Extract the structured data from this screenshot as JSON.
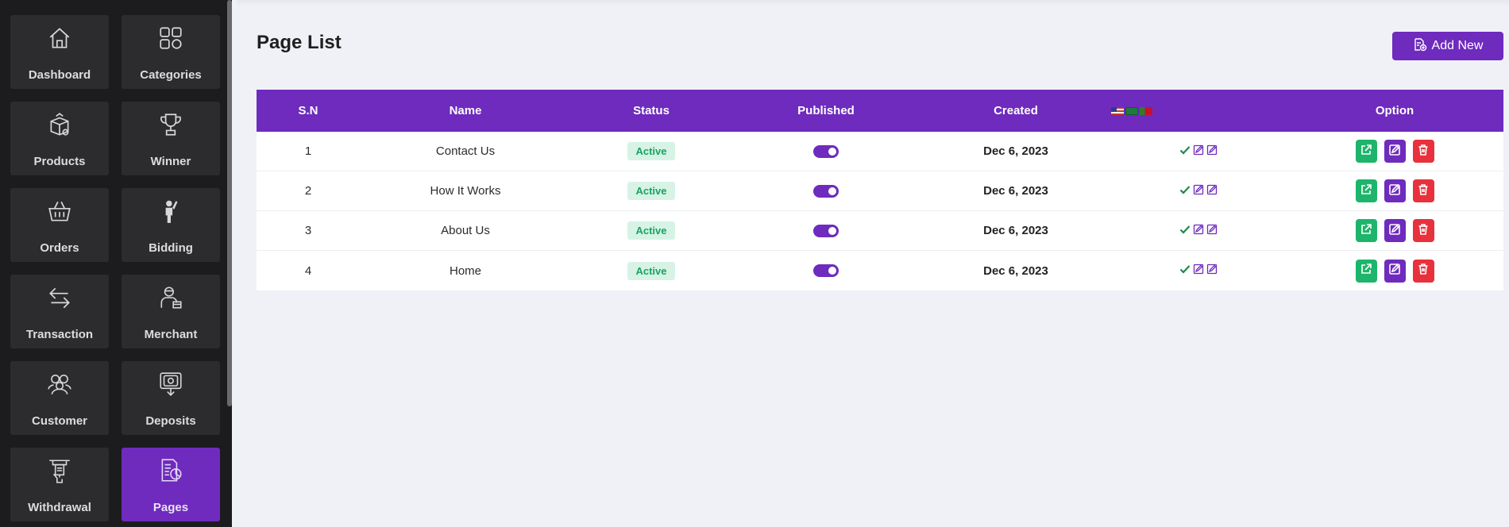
{
  "sidebar": {
    "items": [
      {
        "label": "Dashboard",
        "icon": "home-icon"
      },
      {
        "label": "Categories",
        "icon": "grid-icon"
      },
      {
        "label": "Products",
        "icon": "box-icon"
      },
      {
        "label": "Winner",
        "icon": "trophy-icon"
      },
      {
        "label": "Orders",
        "icon": "basket-icon"
      },
      {
        "label": "Bidding",
        "icon": "hand-raise-icon"
      },
      {
        "label": "Transaction",
        "icon": "arrows-exchange-icon"
      },
      {
        "label": "Merchant",
        "icon": "merchant-icon"
      },
      {
        "label": "Customer",
        "icon": "users-icon"
      },
      {
        "label": "Deposits",
        "icon": "deposit-icon"
      },
      {
        "label": "Withdrawal",
        "icon": "withdraw-icon"
      },
      {
        "label": "Pages",
        "icon": "pages-icon",
        "active": true
      }
    ]
  },
  "header": {
    "title": "Page List",
    "add_button_label": "Add New"
  },
  "table": {
    "columns": [
      "S.N",
      "Name",
      "Status",
      "Published",
      "Created",
      "",
      "Option"
    ],
    "language_flags": [
      "us-flag",
      "sa-flag",
      "pt-flag"
    ],
    "rows": [
      {
        "sn": "1",
        "name": "Contact Us",
        "status": "Active",
        "published": true,
        "created": "Dec 6, 2023"
      },
      {
        "sn": "2",
        "name": "How It Works",
        "status": "Active",
        "published": true,
        "created": "Dec 6, 2023"
      },
      {
        "sn": "3",
        "name": "About Us",
        "status": "Active",
        "published": true,
        "created": "Dec 6, 2023"
      },
      {
        "sn": "4",
        "name": "Home",
        "status": "Active",
        "published": true,
        "created": "Dec 6, 2023"
      }
    ]
  },
  "colors": {
    "accent": "#6e2bbd",
    "success": "#1db56b",
    "danger": "#e8313c",
    "sidebar_bg": "#1c1c1e",
    "tile_bg": "#2c2c2e"
  }
}
